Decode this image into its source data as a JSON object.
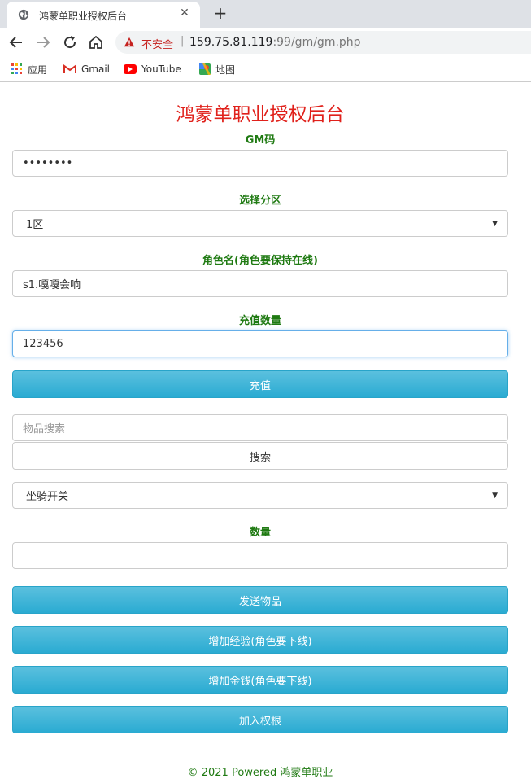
{
  "browser": {
    "tab_title": "鸿蒙单职业授权后台",
    "tab_close": "✕",
    "new_tab": "+",
    "security_label": "不安全",
    "url_host": "159.75.81.119",
    "url_rest": ":99/gm/gm.php",
    "bookmarks": [
      {
        "label": "应用",
        "icon": "apps-grid-icon"
      },
      {
        "label": "Gmail",
        "icon": "gmail-icon"
      },
      {
        "label": "YouTube",
        "icon": "youtube-icon"
      },
      {
        "label": "地图",
        "icon": "maps-icon"
      }
    ]
  },
  "page": {
    "title": "鸿蒙单职业授权后台",
    "gm_code": {
      "label": "GM码",
      "value": "••••••••"
    },
    "zone": {
      "label": "选择分区",
      "selected": "1区"
    },
    "role": {
      "label": "角色名(角色要保持在线)",
      "value": "s1.嘎嘎会响"
    },
    "recharge": {
      "label": "充值数量",
      "value": "123456",
      "button": "充值"
    },
    "item_search": {
      "placeholder": "物品搜索",
      "button": "搜索"
    },
    "item_select": {
      "selected": "坐骑开关"
    },
    "quantity": {
      "label": "数量",
      "value": ""
    },
    "buttons": {
      "send_item": "发送物品",
      "add_exp": "增加经验(角色要下线)",
      "add_money": "增加金钱(角色要下线)",
      "add_root": "加入权根"
    },
    "footer": "© 2021 Powered 鸿蒙单职业"
  },
  "colors": {
    "title": "#e0211b",
    "label": "#1f7a12",
    "button": "#2aabd2"
  }
}
